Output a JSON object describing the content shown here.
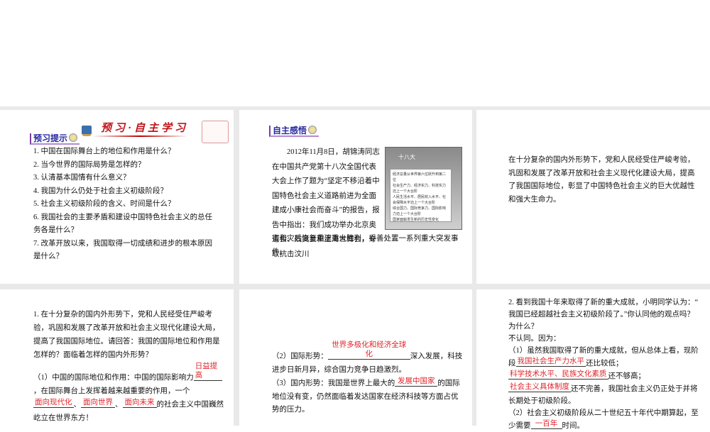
{
  "slide1": {
    "banner": "预习·自主学习",
    "tag": "预习提示",
    "items": [
      "1. 中国在国际舞台上的地位和作用是什么？",
      "2. 当今世界的国际局势是怎样的？",
      "3. 认清基本国情有什么意义？",
      "4. 我国为什么仍处于社会主义初级阶段？",
      "5. 社会主义初级阶段的含义、时间是什么？",
      "6. 我国社会的主要矛盾和建设中国特色社会主义的总任务各是什么？",
      "7. 改革开放以来，我国取得一切成绩和进步的根本原因是什么？"
    ]
  },
  "slide2": {
    "tag": "自主感悟",
    "text": "2012年11月8日，胡锦涛同志在中国共产党第十八次全国代表大会上作了题为“坚定不移沿着中国特色社会主义道路前进为全面建成小康社会而奋斗”的报告，报告中指出：我们成功举办北京奥运会、残奥会和上海世博会，夺取抗击汶川",
    "text_end": "害和灾后恢复重建重大胜利，妥善处置一系列重大突发事件。",
    "image_title": "十八大",
    "image_lines": [
      "经济总量从世界第六位跃升到第二位",
      "社会生产力、经济实力、科技实力迈上一个大台阶",
      "人民生活水平、居民收入水平、社会保障水平迈上一个大台阶",
      "综合国力、国际竞争力、国际影响力迈上一个大台阶",
      "国家面貌发生新的历史性变化"
    ]
  },
  "slide3": {
    "text": "在十分复杂的国内外形势下，党和人民经受住严峻考验，巩固和发展了改革开放和社会主义现代化建设大局，提高了我国国际地位，彰显了中国特色社会主义的巨大优越性和强大生命力。"
  },
  "slide4": {
    "question": "1. 在十分复杂的国内外形势下，党和人民经受住严峻考验，巩固和发展了改革开放和社会主义现代化建设大局，提高了我国国际地位。请回答：我国的国际地位和作用是怎样的？面临着怎样的国内外形势？",
    "p1_a": "（1）中国的国际地位和作用：中国的国际影响力",
    "blank1": "日益提高",
    "p1_b": "，在国际舞台上发挥着越来越重要的作用，一个",
    "blank2": "面向现代化",
    "sep1": "、",
    "blank3": "面向世界",
    "sep2": "、",
    "blank4": "面向未来",
    "p1_c": "的社会主义中国巍然屹立在世界东方！"
  },
  "slide5": {
    "p2_a": "（2）国际形势：",
    "blank1": "世界多极化和经济全球化",
    "p2_b": "深入发展，科技进步日新月异，综合国力竞争日趋激烈。",
    "p3_a": "（3）国内形势：我国是世界上最大的",
    "blank2": "发展中国家",
    "p3_b": "的国际地位没有变，仍然面临着发达国家在经济科技等方面占优势的压力。"
  },
  "slide6": {
    "question": "2. 看到我国十年来取得了新的重大成就，小明同学认为：“ 我国已经超越社会主义初级阶段了。”你认同他的观点吗？为什么？",
    "answer": "不认同。因为：",
    "p1_a": "（1）虽然我国取得了新的重大成就，但从总体上看，现阶段",
    "blank1": "我国社会生产力水平",
    "p1_b": "还比较低；",
    "blank2": "科学技术水平、民族文化素质",
    "p1_c": "还不够高；",
    "blank3": "社会主义具体制度",
    "p1_d": "还不完善，我国社会主义仍正处于并将长期处于初级阶段。",
    "p2_a": "（2）社会主义初级阶段从二十世纪五十年代中期算起，至少需要",
    "blank4": "一百年",
    "p2_b": "时间。"
  }
}
